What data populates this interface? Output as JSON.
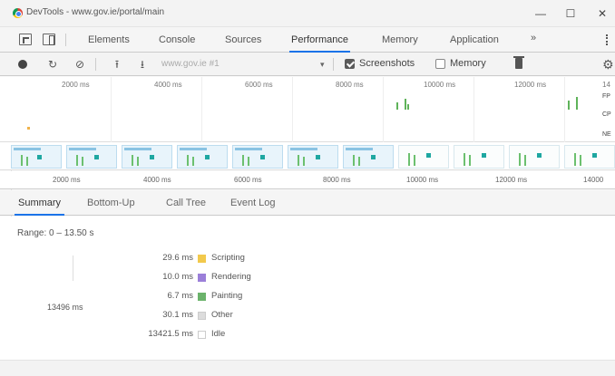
{
  "window": {
    "title": "DevTools - www.gov.ie/portal/main",
    "buttons": {
      "minimize": "—",
      "maximize": "☐",
      "close": "✕"
    }
  },
  "tabs": {
    "items": [
      "Elements",
      "Console",
      "Sources",
      "Performance",
      "Memory",
      "Application"
    ],
    "active": "Performance",
    "more": "»"
  },
  "toolbar": {
    "reload": "↻",
    "clear": "⊘",
    "upload": "⭱",
    "download": "⭳",
    "url_placeholder": "www.gov.ie #1",
    "caret": "▾",
    "screenshots_label": "Screenshots",
    "screenshots_checked": true,
    "memory_label": "Memory",
    "memory_checked": false,
    "settings": "⚙"
  },
  "overview": {
    "ticks": [
      "2000 ms",
      "4000 ms",
      "6000 ms",
      "8000 ms",
      "10000 ms",
      "12000 ms",
      "14"
    ],
    "side_labels": [
      "FP",
      "CP",
      "NE"
    ]
  },
  "ruler": {
    "ticks": [
      "2000 ms",
      "4000 ms",
      "6000 ms",
      "8000 ms",
      "10000 ms",
      "12000 ms",
      "14000"
    ]
  },
  "subtabs": {
    "items": [
      "Summary",
      "Bottom-Up",
      "Call Tree",
      "Event Log"
    ],
    "active": "Summary"
  },
  "summary": {
    "range": "Range: 0 – 13.50 s",
    "total": "13496 ms",
    "legend": [
      {
        "value": "29.6 ms",
        "name": "Scripting",
        "color": "#f2c94c"
      },
      {
        "value": "10.0 ms",
        "name": "Rendering",
        "color": "#9b7fd9"
      },
      {
        "value": "6.7 ms",
        "name": "Painting",
        "color": "#6bb36b"
      },
      {
        "value": "30.1 ms",
        "name": "Other",
        "color": "#dcdcdc"
      },
      {
        "value": "13421.5 ms",
        "name": "Idle",
        "color": "#ffffff"
      }
    ]
  }
}
